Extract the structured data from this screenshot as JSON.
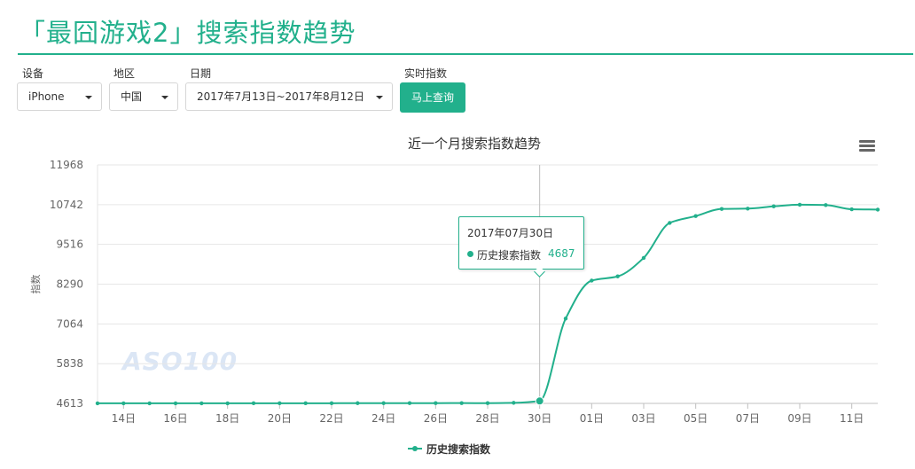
{
  "page": {
    "title": "「最囧游戏2」搜索指数趋势"
  },
  "filters": {
    "device_label": "设备",
    "device_value": "iPhone",
    "region_label": "地区",
    "region_value": "中国",
    "date_label": "日期",
    "date_value": "2017年7月13日~2017年8月12日",
    "realtime_label": "实时指数",
    "query_button": "马上查询"
  },
  "watermark": "ASO100",
  "tooltip": {
    "date": "2017年07月30日",
    "series": "历史搜索指数",
    "value": "4687"
  },
  "chart_data": {
    "type": "line",
    "title": "近一个月搜索指数趋势",
    "ylabel": "指数",
    "xlabel": "",
    "ylim": [
      4613,
      11968
    ],
    "yticks": [
      "11968",
      "10742",
      "9516",
      "8290",
      "7064",
      "5838",
      "4613"
    ],
    "xticks": [
      "14日",
      "16日",
      "18日",
      "20日",
      "22日",
      "24日",
      "26日",
      "28日",
      "30日",
      "01日",
      "03日",
      "05日",
      "07日",
      "09日",
      "11日"
    ],
    "x": [
      "2017-07-13",
      "2017-07-14",
      "2017-07-15",
      "2017-07-16",
      "2017-07-17",
      "2017-07-18",
      "2017-07-19",
      "2017-07-20",
      "2017-07-21",
      "2017-07-22",
      "2017-07-23",
      "2017-07-24",
      "2017-07-25",
      "2017-07-26",
      "2017-07-27",
      "2017-07-28",
      "2017-07-29",
      "2017-07-30",
      "2017-07-31",
      "2017-08-01",
      "2017-08-02",
      "2017-08-03",
      "2017-08-04",
      "2017-08-05",
      "2017-08-06",
      "2017-08-07",
      "2017-08-08",
      "2017-08-09",
      "2017-08-10",
      "2017-08-11",
      "2017-08-12"
    ],
    "series": [
      {
        "name": "历史搜索指数",
        "color": "#22b08c",
        "values": [
          4615,
          4615,
          4615,
          4616,
          4616,
          4616,
          4617,
          4617,
          4617,
          4618,
          4620,
          4620,
          4621,
          4621,
          4622,
          4621,
          4630,
          4687,
          7230,
          8400,
          8530,
          9100,
          10180,
          10390,
          10610,
          10620,
          10690,
          10740,
          10730,
          10600,
          10590
        ]
      }
    ],
    "grid": true,
    "legend": "bottom-center",
    "highlight_index": 17
  }
}
